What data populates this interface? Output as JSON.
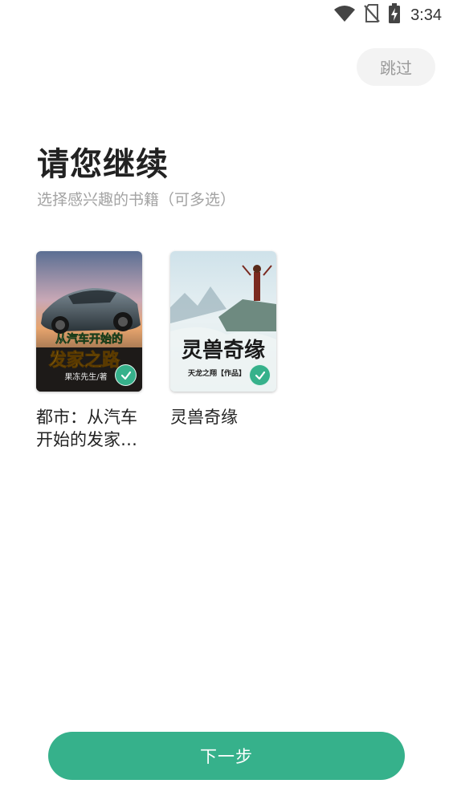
{
  "status_bar": {
    "time": "3:34",
    "icons": [
      "wifi-icon",
      "no-sim-icon",
      "battery-charging-icon"
    ]
  },
  "header": {
    "skip_label": "跳过"
  },
  "main": {
    "title": "请您继续",
    "subtitle": "选择感兴趣的书籍（可多选）",
    "books": [
      {
        "title": "都市：从汽车开始的发家之路",
        "cover_title_line1": "从汽车开始的",
        "cover_title_line2": "发家之路",
        "cover_author": "果冻先生/著",
        "selected": true,
        "selected_icon": "check-icon"
      },
      {
        "title": "灵兽奇缘",
        "cover_title": "灵兽奇缘",
        "cover_author": "天龙之翔【作品】",
        "selected": true,
        "selected_icon": "check-icon"
      }
    ]
  },
  "footer": {
    "next_label": "下一步"
  },
  "colors": {
    "accent": "#36b18b",
    "skip_bg": "#f3f3f3",
    "subtitle": "#a3a3a3"
  }
}
